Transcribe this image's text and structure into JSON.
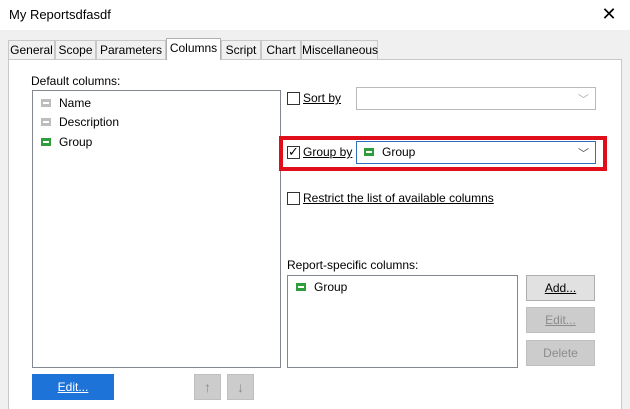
{
  "window": {
    "title": "My Reportsdfasdf"
  },
  "tabs": [
    {
      "label": "General"
    },
    {
      "label": "Scope"
    },
    {
      "label": "Parameters"
    },
    {
      "label": "Columns"
    },
    {
      "label": "Script"
    },
    {
      "label": "Chart"
    },
    {
      "label": "Miscellaneous"
    }
  ],
  "active_tab": "Columns",
  "default_columns": {
    "label": "Default columns:",
    "items": [
      {
        "label": "Name",
        "icon": "grey-column-icon"
      },
      {
        "label": "Description",
        "icon": "grey-column-icon"
      },
      {
        "label": "Group",
        "icon": "green-column-icon"
      }
    ],
    "edit_label": "Edit...",
    "up_icon": "↑",
    "down_icon": "↓"
  },
  "sort_by": {
    "label": "Sort by",
    "checked": false,
    "value": ""
  },
  "group_by": {
    "label": "Group by",
    "checked": true,
    "value": "Group"
  },
  "restrict": {
    "label": "Restrict the list of available columns",
    "checked": false
  },
  "report_columns": {
    "label": "Report-specific columns:",
    "items": [
      {
        "label": "Group",
        "icon": "green-column-icon"
      }
    ],
    "add_label": "Add...",
    "edit_label": "Edit...",
    "delete_label": "Delete"
  },
  "colors": {
    "accent": "#1e73d8",
    "highlight": "#e00e1b",
    "group_icon": "#2e9d3a"
  }
}
